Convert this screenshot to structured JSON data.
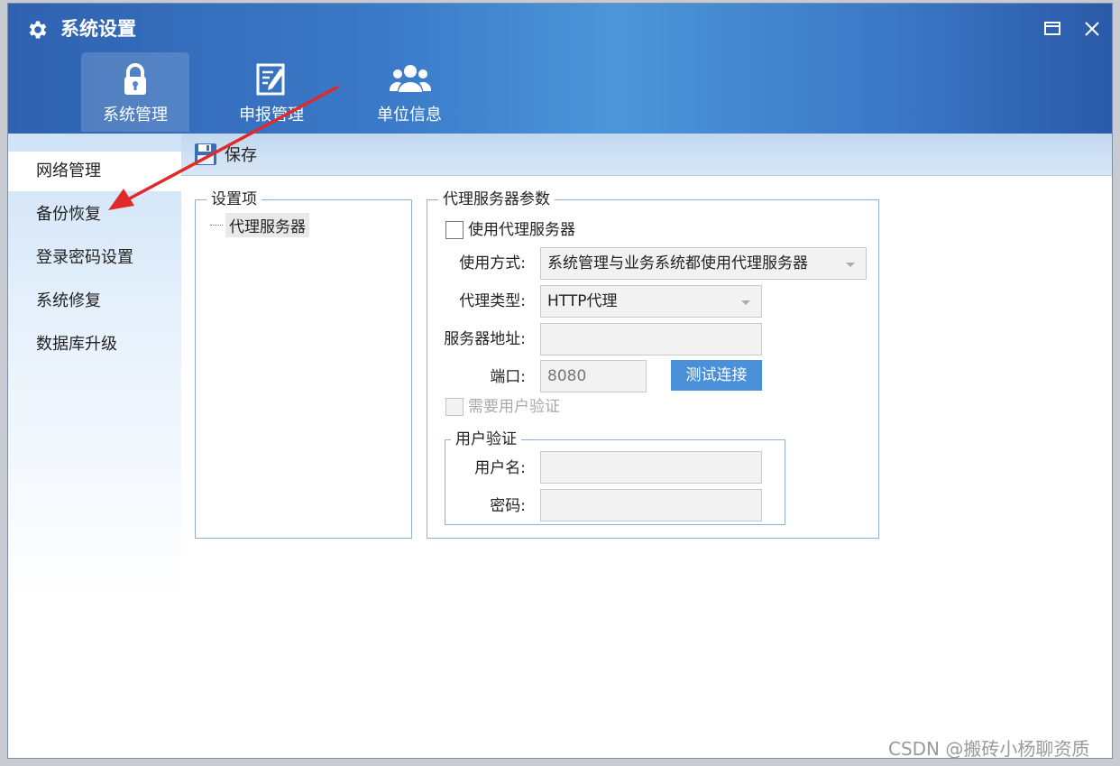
{
  "window": {
    "title": "系统设置"
  },
  "top_tabs": [
    {
      "label": "系统管理",
      "icon": "lock-icon"
    },
    {
      "label": "申报管理",
      "icon": "edit-form-icon"
    },
    {
      "label": "单位信息",
      "icon": "users-icon"
    }
  ],
  "sidebar": {
    "items": [
      {
        "label": "网络管理"
      },
      {
        "label": "备份恢复"
      },
      {
        "label": "登录密码设置"
      },
      {
        "label": "系统修复"
      },
      {
        "label": "数据库升级"
      }
    ]
  },
  "toolbar": {
    "save_label": "保存"
  },
  "settings_tree": {
    "legend": "设置项",
    "node": "代理服务器"
  },
  "proxy": {
    "legend": "代理服务器参数",
    "use_proxy_label": "使用代理服务器",
    "mode_label": "使用方式:",
    "mode_value": "系统管理与业务系统都使用代理服务器",
    "type_label": "代理类型:",
    "type_value": "HTTP代理",
    "address_label": "服务器地址:",
    "address_value": "",
    "port_label": "端口:",
    "port_value": "8080",
    "test_button": "测试连接",
    "need_auth_label": "需要用户验证",
    "auth_legend": "用户验证",
    "username_label": "用户名:",
    "username_value": "",
    "password_label": "密码:",
    "password_value": ""
  },
  "watermark": "CSDN @搬砖小杨聊资质",
  "colors": {
    "header_blue": "#3b7bc9",
    "accent_button": "#4a90d9",
    "arrow_red": "#e02a2a"
  }
}
